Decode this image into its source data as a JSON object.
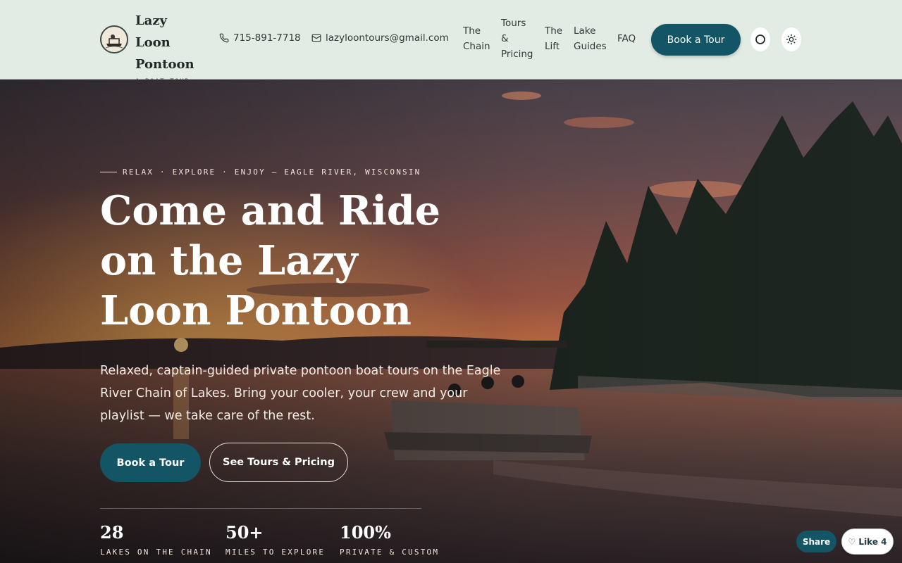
{
  "header": {
    "brand_name": "Lazy Loon Pontoon",
    "brand_tagline": "A BOAT TOUR COMPANY",
    "phone": "715-891-7718",
    "email": "lazyloontours@gmail.com",
    "nav": [
      "The Chain",
      "Tours & Pricing",
      "The Lift",
      "Lake Guides",
      "FAQ"
    ],
    "cta_label": "Book a Tour",
    "icons": [
      "phone-icon",
      "mail-icon",
      "circle-icon",
      "sun-icon"
    ]
  },
  "hero": {
    "eyebrow": "RELAX · EXPLORE · ENJOY — EAGLE RIVER, WISCONSIN",
    "headline": "Come and Ride on the Lazy Loon Pontoon",
    "lead": "Relaxed, captain-guided private pontoon boat tours on the Eagle River Chain of Lakes. Bring your cooler, your crew and your playlist — we take care of the rest.",
    "primary_button": "Book a Tour",
    "secondary_button": "See Tours & Pricing",
    "stats": [
      {
        "value": "28",
        "label": "LAKES ON THE CHAIN"
      },
      {
        "value": "50+",
        "label": "MILES TO EXPLORE"
      },
      {
        "value": "100%",
        "label": "PRIVATE & CUSTOM"
      }
    ]
  },
  "floating": {
    "share_label": "Share",
    "like_label": "♡ Like 4"
  },
  "colors": {
    "header_bg": "#e3ebe5",
    "accent": "#135565"
  }
}
